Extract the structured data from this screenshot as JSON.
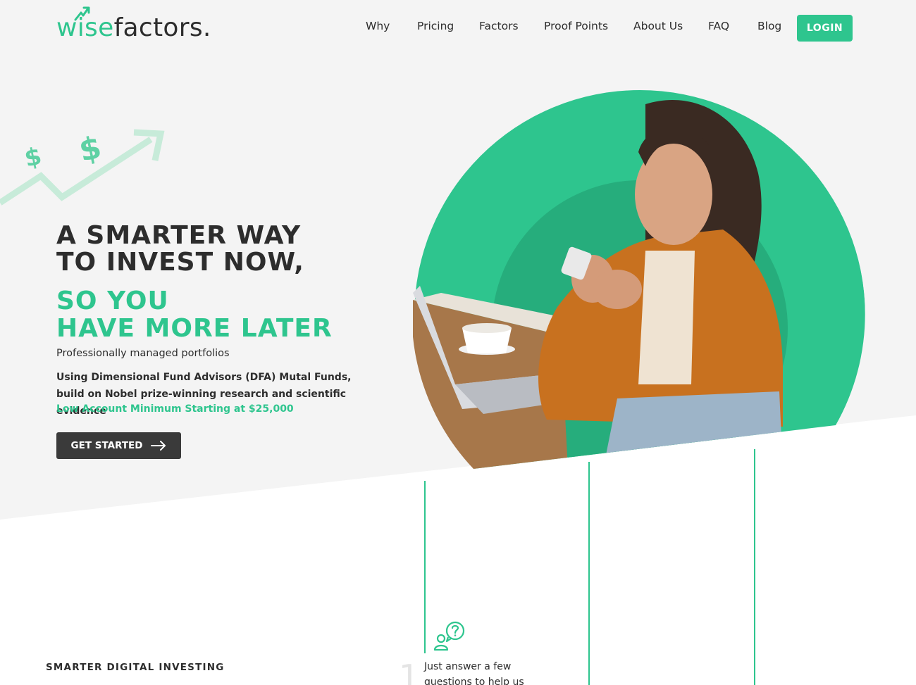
{
  "brand": {
    "logo_wise": "wise",
    "logo_factors": "factors.",
    "primary_color": "#2ec58e",
    "dark_color": "#3a3a3a"
  },
  "nav": {
    "items": [
      {
        "label": "Why"
      },
      {
        "label": "Pricing"
      },
      {
        "label": "Factors"
      },
      {
        "label": "Proof Points"
      },
      {
        "label": "About Us"
      },
      {
        "label": "FAQ"
      },
      {
        "label": "Blog"
      }
    ],
    "login_label": "LOGIN"
  },
  "hero": {
    "headline_line1": "A SMARTER WAY",
    "headline_line2": "TO INVEST NOW,",
    "accent_line1": "SO YOU",
    "accent_line2": "HAVE MORE LATER",
    "tagline": "Professionally managed portfolios",
    "description": "Using Dimensional Fund Advisors (DFA) Mutal Funds, build on Nobel prize-winning research and scientific evidence",
    "minimum": "Low Account Minimum Starting at $25,000",
    "cta_label": "GET STARTED",
    "cta_icon": "arrow-right-icon",
    "deco_symbol": "$"
  },
  "steps": {
    "section_label": "SMARTER DIGITAL INVESTING",
    "items": [
      {
        "number": "1",
        "icon": "question-chat-icon",
        "text": "Just answer a few questions to help us"
      }
    ]
  }
}
